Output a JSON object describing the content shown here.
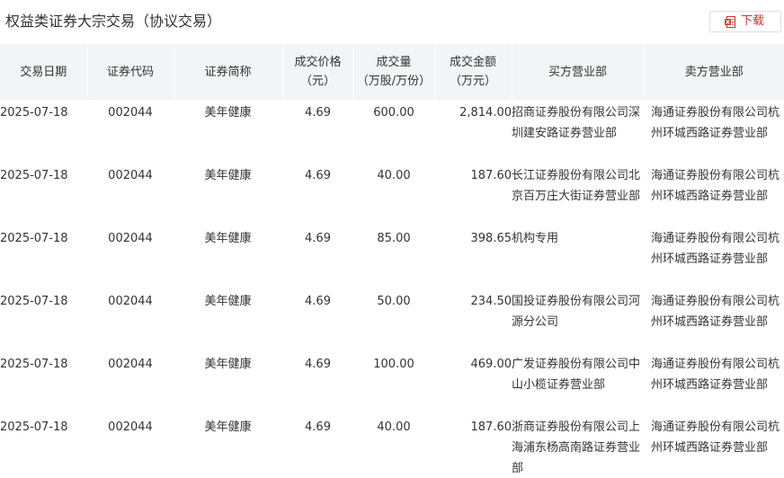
{
  "header": {
    "title": "权益类证券大宗交易（协议交易）",
    "download_label": "下载"
  },
  "colors": {
    "accent": "#d23030",
    "header_bg": "#f3f4f7",
    "text": "#333333"
  },
  "table": {
    "columns": [
      "交易日期",
      "证券代码",
      "证券简称",
      "成交价格\n（元）",
      "成交量\n（万股/万份）",
      "成交金额\n（万元）",
      "买方营业部",
      "卖方营业部"
    ],
    "rows": [
      {
        "date": "2025-07-18",
        "code": "002044",
        "name": "美年健康",
        "price": "4.69",
        "volume": "600.00",
        "amount": "2,814.00",
        "buyer": "招商证券股份有限公司深圳建安路证券营业部",
        "seller": "海通证券股份有限公司杭州环城西路证券营业部"
      },
      {
        "date": "2025-07-18",
        "code": "002044",
        "name": "美年健康",
        "price": "4.69",
        "volume": "40.00",
        "amount": "187.60",
        "buyer": "长江证券股份有限公司北京百万庄大街证券营业部",
        "seller": "海通证券股份有限公司杭州环城西路证券营业部"
      },
      {
        "date": "2025-07-18",
        "code": "002044",
        "name": "美年健康",
        "price": "4.69",
        "volume": "85.00",
        "amount": "398.65",
        "buyer": "机构专用",
        "seller": "海通证券股份有限公司杭州环城西路证券营业部"
      },
      {
        "date": "2025-07-18",
        "code": "002044",
        "name": "美年健康",
        "price": "4.69",
        "volume": "50.00",
        "amount": "234.50",
        "buyer": "国投证券股份有限公司河源分公司",
        "seller": "海通证券股份有限公司杭州环城西路证券营业部"
      },
      {
        "date": "2025-07-18",
        "code": "002044",
        "name": "美年健康",
        "price": "4.69",
        "volume": "100.00",
        "amount": "469.00",
        "buyer": "广发证券股份有限公司中山小榄证券营业部",
        "seller": "海通证券股份有限公司杭州环城西路证券营业部"
      },
      {
        "date": "2025-07-18",
        "code": "002044",
        "name": "美年健康",
        "price": "4.69",
        "volume": "40.00",
        "amount": "187.60",
        "buyer": "浙商证券股份有限公司上海浦东杨高南路证券营业部",
        "seller": "海通证券股份有限公司杭州环城西路证券营业部"
      }
    ]
  }
}
